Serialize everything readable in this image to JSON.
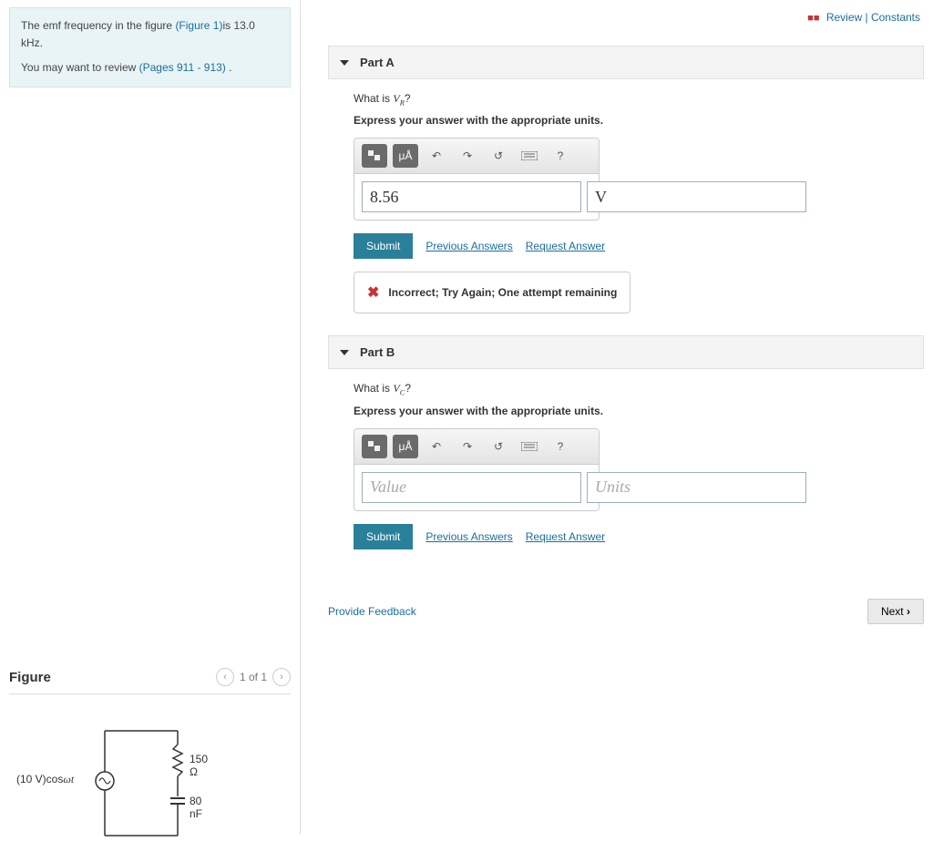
{
  "topLinks": {
    "review": "Review",
    "constants": "Constants"
  },
  "intro": {
    "line1a": "The emf frequency in the figure ",
    "figLink": "(Figure 1)",
    "line1b": "is 13.0 kHz.",
    "line2a": "You may want to review ",
    "pagesLink": "(Pages 911 - 913)",
    "line2b": " ."
  },
  "partA": {
    "title": "Part A",
    "question_prefix": "What is ",
    "question_var": "V",
    "question_sub": "R",
    "question_suffix": "?",
    "instruction": "Express your answer with the appropriate units.",
    "value": "8.56",
    "unit": "V",
    "submit": "Submit",
    "prevAnswers": "Previous Answers",
    "reqAnswer": "Request Answer",
    "feedback": "Incorrect; Try Again; One attempt remaining"
  },
  "partB": {
    "title": "Part B",
    "question_prefix": "What is ",
    "question_var": "V",
    "question_sub": "C",
    "question_suffix": "?",
    "instruction": "Express your answer with the appropriate units.",
    "valuePlaceholder": "Value",
    "unitPlaceholder": "Units",
    "submit": "Submit",
    "prevAnswers": "Previous Answers",
    "reqAnswer": "Request Answer"
  },
  "toolbar": {
    "units": "μÅ",
    "help": "?"
  },
  "footer": {
    "provideFeedback": "Provide Feedback",
    "next": "Next"
  },
  "figure": {
    "heading": "Figure",
    "pager": "1 of 1",
    "source": "(10 V)cos",
    "omega": "ωt",
    "resistor": "150 Ω",
    "capacitor": "80 nF"
  }
}
